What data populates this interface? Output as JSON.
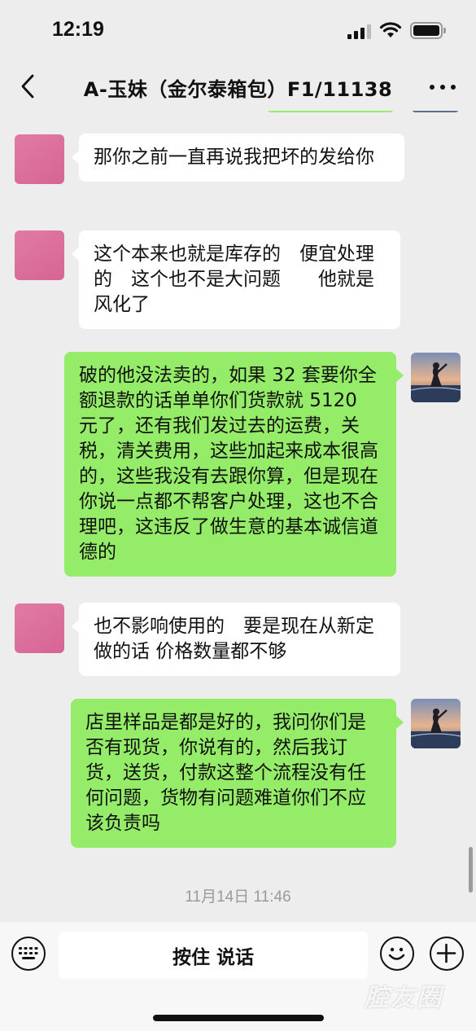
{
  "status_bar": {
    "time": "12:19"
  },
  "header": {
    "title": "A-玉妹（金尔泰箱包）F1/11138"
  },
  "messages": [
    {
      "side": "in",
      "text": "那你之前一直再说我把坏的发给你"
    },
    {
      "side": "in",
      "text": "这个本来也就是库存的　便宜处理的　这个也不是大问题　　他就是风化了"
    },
    {
      "side": "out",
      "text": "破的他没法卖的，如果 32 套要你全额退款的话单单你们货款就 5120 元了，还有我们发过去的运费，关税，清关费用，这些加起来成本很高的，这些我没有去跟你算，但是现在你说一点都不帮客户处理，这也不合理吧，这违反了做生意的基本诚信道德的"
    },
    {
      "side": "in",
      "text": "也不影响使用的　要是现在从新定做的话 价格数量都不够"
    },
    {
      "side": "out",
      "text": "店里样品是都是好的，我问你们是否有现货，你说有的，然后我订货，送货，付款这整个流程没有任何问题，货物有问题难道你们不应该负责吗"
    }
  ],
  "timestamp": "11月14日 11:46",
  "input_bar": {
    "voice_label": "按住 说话"
  },
  "watermark": "腔友圈",
  "colors": {
    "outgoing_bubble": "#95ec69",
    "incoming_bubble": "#ffffff",
    "background": "#ededed"
  }
}
